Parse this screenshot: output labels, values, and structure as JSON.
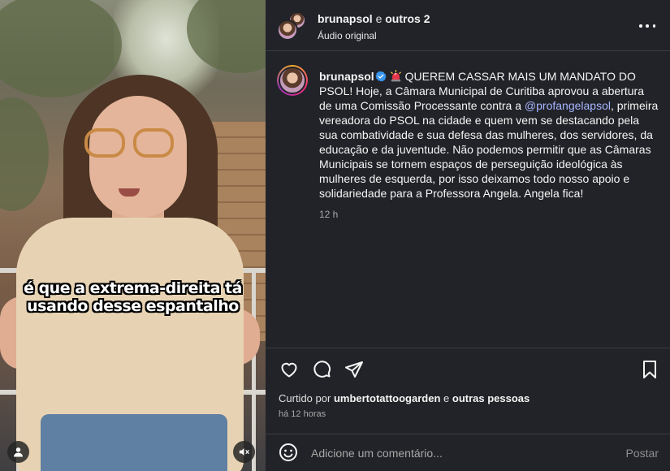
{
  "video": {
    "caption_lines": [
      "é que a extrema-direita tá",
      "usando desse espantalho"
    ],
    "tag_icon": "user-icon",
    "mute_icon": "speaker-muted-icon"
  },
  "header": {
    "owner": "brunapsol",
    "connector": "e",
    "collaborators": "outros 2",
    "audio": "Áudio original",
    "more_icon": "more-horizontal-icon"
  },
  "comment": {
    "username": "brunapsol",
    "text_before_mention": "QUEREM CASSAR MAIS UM MANDATO DO PSOL! Hoje, a Câmara Municipal de Curitiba aprovou a abertura de uma Comissão Processante contra a ",
    "mention": "@profangelapsol",
    "text_after_mention": ", primeira vereadora do PSOL na cidade e quem vem se destacando pela sua combatividade e sua defesa das mulheres, dos servidores, da educação e da juventude. Não podemos permitir que as Câmaras Municipais se tornem espaços de perseguição ideológica às mulheres de esquerda, por isso deixamos todo nosso apoio e solidariedade para a Professora Angela. Angela fica!",
    "time": "12 h"
  },
  "actions": {
    "liked_prefix": "Curtido por",
    "liked_user": "umbertotattoogarden",
    "liked_connector": "e",
    "liked_others": "outras pessoas",
    "time_ago": "há 12 horas"
  },
  "composer": {
    "placeholder": "Adicione um comentário...",
    "post_label": "Postar"
  },
  "colors": {
    "background": "#212328",
    "mention": "#a7b5ff",
    "verified": "#3897f0",
    "muted_text": "#a8a8a8"
  }
}
